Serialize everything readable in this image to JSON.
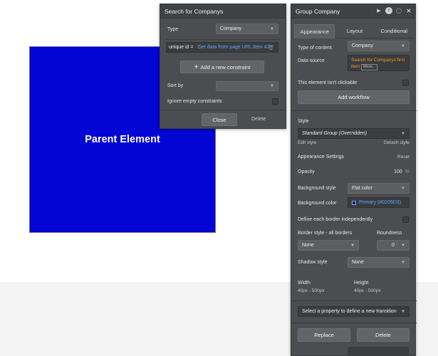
{
  "canvas": {
    "element_label": "Parent Element",
    "element_color": "#0205D3"
  },
  "search_panel": {
    "title": "Search for Companys",
    "type_label": "Type",
    "type_value": "Company",
    "constraint_key": "unique id =",
    "constraint_value": "Get data from page URL:item #2",
    "add_constraint": "Add a new constraint",
    "sort_by_label": "Sort by",
    "ignore_empty_label": "Ignore empty constraints",
    "close_label": "Close",
    "delete_label": "Delete"
  },
  "group_panel": {
    "title": "Group Company",
    "tabs": [
      "Appearance",
      "Layout",
      "Conditional"
    ],
    "type_of_content_label": "Type of content",
    "type_of_content_value": "Company",
    "data_source_label": "Data source",
    "data_source_value_1": "Search for Companys:first",
    "data_source_value_2": "item",
    "more_label": "More...",
    "not_clickable_label": "This element isn't clickable",
    "add_workflow": "Add workflow",
    "style_label": "Style",
    "style_value": "Standard Group (Overridden)",
    "edit_style": "Edit style",
    "detach_style": "Detach style",
    "appearance_settings": "Appearance Settings",
    "reset": "Reset",
    "opacity_label": "Opacity",
    "opacity_value": "100",
    "opacity_unit": "%",
    "bg_style_label": "Background style",
    "bg_style_value": "Flat color",
    "bg_color_label": "Background color",
    "bg_color_value": "Primary (#0205D3)",
    "define_border_label": "Define each border independently",
    "border_style_label": "Border style - all borders",
    "roundness_label": "Roundness",
    "border_value": "None",
    "roundness_value": "0",
    "shadow_label": "Shadow style",
    "shadow_value": "None",
    "width_label": "Width",
    "width_value": "40px - 500px",
    "height_label": "Height",
    "height_value": "40px - 500px",
    "transition_placeholder": "Select a property to define a new transition",
    "replace_label": "Replace",
    "delete_label": "Delete"
  },
  "icons": [
    "play-icon",
    "info-icon",
    "comment-icon",
    "close-icon",
    "dropdown-caret-icon",
    "plus-icon",
    "trash-icon"
  ]
}
